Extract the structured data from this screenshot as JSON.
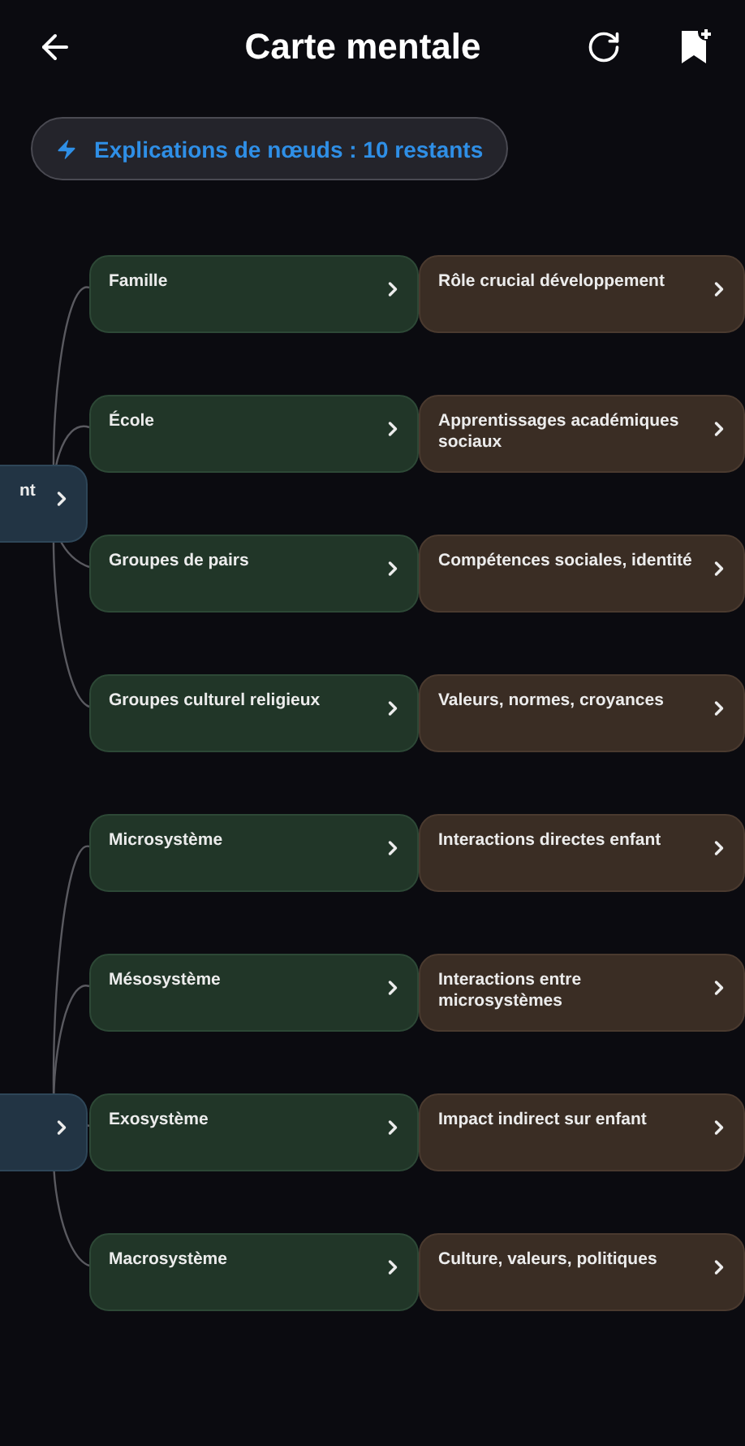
{
  "header": {
    "title": "Carte mentale"
  },
  "badge": {
    "text": "Explications de nœuds : 10 restants"
  },
  "groups": [
    {
      "parent": {
        "label": "nt"
      },
      "children": [
        {
          "label": "Famille",
          "detail": "Rôle crucial développement"
        },
        {
          "label": "École",
          "detail": "Apprentissages académiques sociaux"
        },
        {
          "label": "Groupes de pairs",
          "detail": "Compétences sociales, identité"
        },
        {
          "label": "Groupes culturel religieux",
          "detail": "Valeurs, normes, croyances"
        }
      ]
    },
    {
      "children": [
        {
          "label": "Microsystème",
          "detail": "Interactions directes enfant"
        },
        {
          "label": "Mésosystème",
          "detail": "Interactions entre microsystèmes"
        },
        {
          "label": "Exosystème",
          "detail": "Impact indirect sur enfant"
        },
        {
          "label": "Macrosystème",
          "detail": "Culture, valeurs, politiques"
        }
      ]
    }
  ]
}
